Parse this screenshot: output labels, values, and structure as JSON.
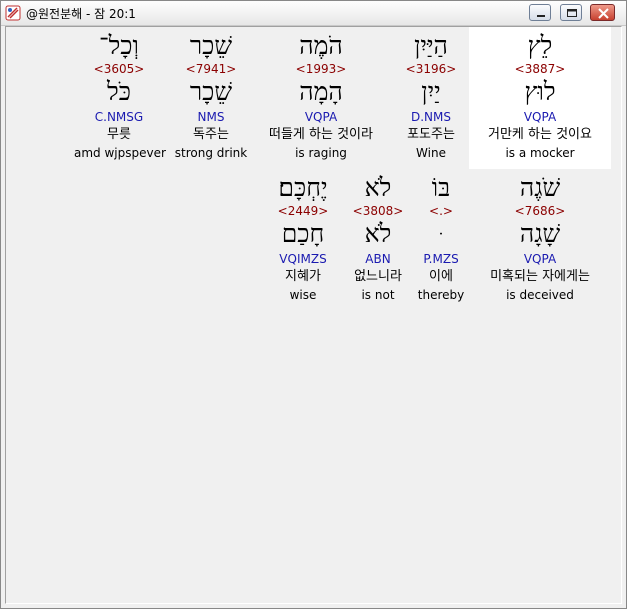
{
  "window": {
    "title": "@원전분해 - 잠 20:1"
  },
  "rows": [
    {
      "words": [
        {
          "heb": "לֵץ",
          "strong": "<3887>",
          "lemma": "לוּץ",
          "morph": "VQPA",
          "kor": "거만케 하는 것이요",
          "eng": "is a mocker"
        },
        {
          "heb": "הַיַּיִן",
          "strong": "<3196>",
          "lemma": "יַיִן",
          "morph": "D.NMS",
          "kor": "포도주는",
          "eng": "Wine"
        },
        {
          "heb": "הֹמֶה",
          "strong": "<1993>",
          "lemma": "הָמָה",
          "morph": "VQPA",
          "kor": "떠들게 하는 것이라",
          "eng": "is raging"
        },
        {
          "heb": "שֵׁכָר",
          "strong": "<7941>",
          "lemma": "שֵׁכָר",
          "morph": "NMS",
          "kor": "독주는",
          "eng": "strong drink"
        },
        {
          "heb": "וְכָל־",
          "strong": "<3605>",
          "lemma": "כֹּל",
          "morph": "C.NMSG",
          "kor": "무릇",
          "eng": "amd wjpspever"
        }
      ]
    },
    {
      "words": [
        {
          "heb": "שֹׁגֶה",
          "strong": "<7686>",
          "lemma": "שָׁגָה",
          "morph": "VQPA",
          "kor": "미혹되는 자에게는",
          "eng": "is deceived"
        },
        {
          "heb": "בּוֹ",
          "strong": "<.>",
          "lemma": "ּ",
          "morph": "P.MZS",
          "kor": "이에",
          "eng": "thereby"
        },
        {
          "heb": "לֹא",
          "strong": "<3808>",
          "lemma": "לֹא",
          "morph": "ABN",
          "kor": "없느니라",
          "eng": "is not"
        },
        {
          "heb": "יֶחְכָּם׃",
          "strong": "<2449>",
          "lemma": "חָכַם",
          "morph": "VQIMZS",
          "kor": "지혜가",
          "eng": "wise"
        }
      ]
    }
  ]
}
